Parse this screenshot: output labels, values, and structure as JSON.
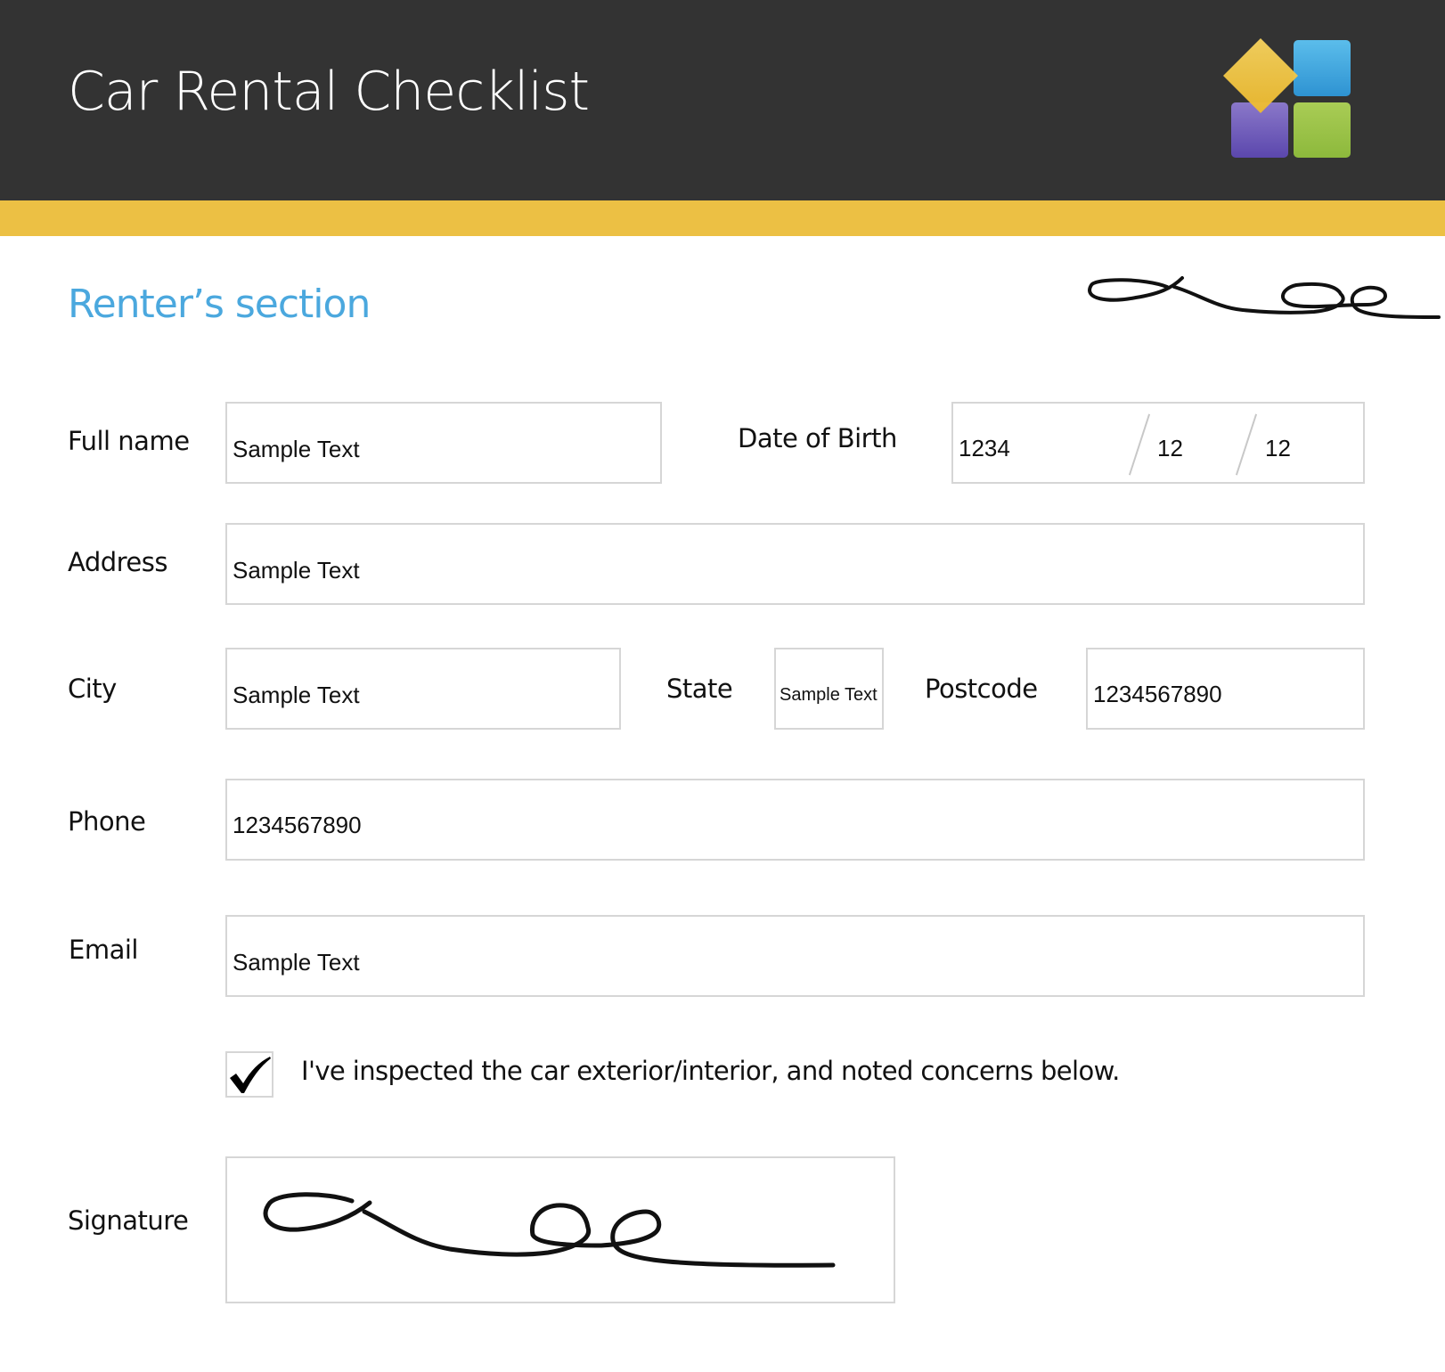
{
  "header": {
    "title": "Car Rental Checklist",
    "logo_icon": "tiles-logo-icon",
    "colors": {
      "background": "#333333",
      "accent_bar": "#ECC044",
      "logo_yellow": "#F2C94C",
      "logo_blue": "#3FA6DF",
      "logo_purple": "#6A55B5",
      "logo_green": "#9BC247"
    }
  },
  "section": {
    "title": "Renter’s section",
    "title_color": "#4BA8DE",
    "signature_icon": "handwritten-signature-icon"
  },
  "form": {
    "full_name": {
      "label": "Full name",
      "value": "Sample Text"
    },
    "date_of_birth": {
      "label": "Date of Birth",
      "year": "1234",
      "month": "12",
      "day": "12"
    },
    "address": {
      "label": "Address",
      "value": "Sample Text"
    },
    "city": {
      "label": "City",
      "value": "Sample Text"
    },
    "state": {
      "label": "State",
      "value": "Sample Text"
    },
    "postcode": {
      "label": "Postcode",
      "value": "1234567890"
    },
    "phone": {
      "label": "Phone",
      "value": "1234567890"
    },
    "email": {
      "label": "Email",
      "value": "Sample Text"
    },
    "inspection": {
      "checked": true,
      "label": "I've inspected the car exterior/interior, and noted concerns below.",
      "icon": "checkmark-icon"
    },
    "signature": {
      "label": "Signature",
      "icon": "handwritten-signature-icon"
    }
  }
}
